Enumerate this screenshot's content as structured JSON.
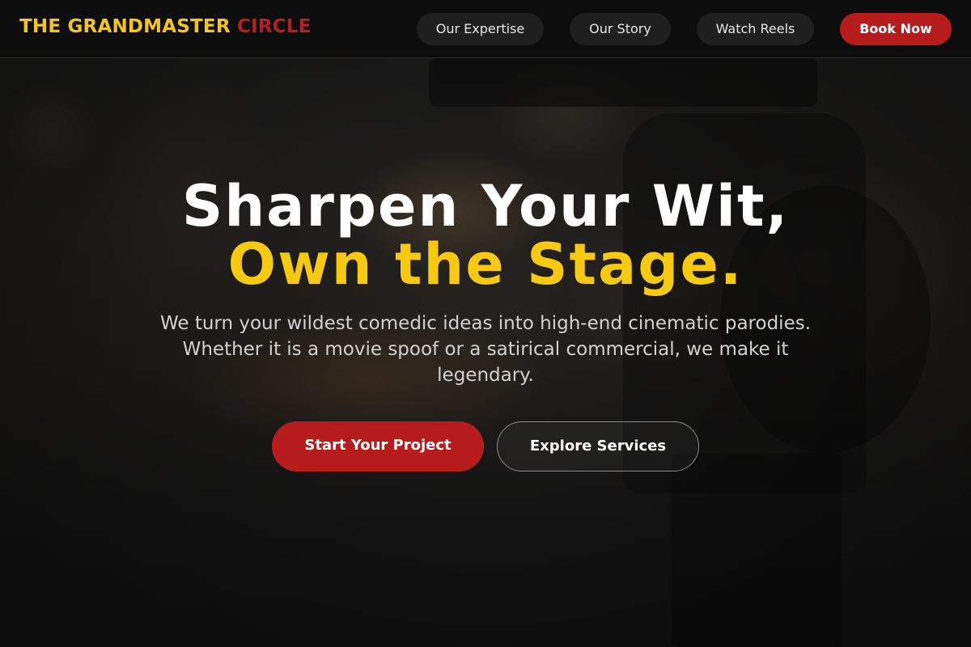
{
  "brand": {
    "name_main": "THE GRANDMASTER",
    "name_accent": "CIRCLE"
  },
  "nav": {
    "items": [
      {
        "label": "Our Expertise"
      },
      {
        "label": "Our Story"
      },
      {
        "label": "Watch Reels"
      }
    ],
    "cta_label": "Book Now"
  },
  "hero": {
    "headline_line1": "Sharpen Your Wit,",
    "headline_line2": "Own the Stage.",
    "subtitle": "We turn your wildest comedic ideas into high-end cinematic parodies. Whether it is a movie spoof or a satirical commercial, we make it legendary.",
    "primary_cta": "Start Your Project",
    "secondary_cta": "Explore Services"
  },
  "colors": {
    "accent_gold": "#f7c910",
    "accent_red": "#b71c1c",
    "nav_bg": "#0d0d0d"
  }
}
